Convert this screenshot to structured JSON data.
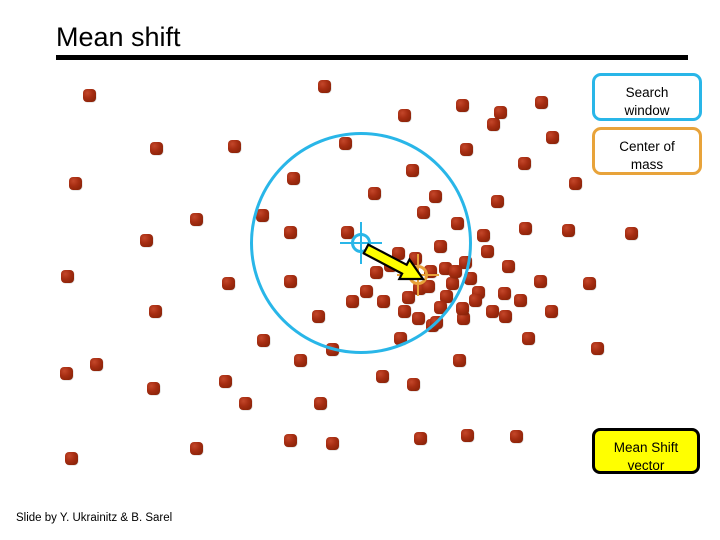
{
  "slide": {
    "title": "Mean shift",
    "footer": "Slide by Y. Ukrainitz & B. Sarel"
  },
  "legend": {
    "search_window": "Search\nwindow",
    "search_window_line1": "Search",
    "search_window_line2": "window",
    "center_of_mass_line1": "Center of",
    "center_of_mass_line2": "mass",
    "mean_shift_vector_line1": "Mean Shift",
    "mean_shift_vector_line2": "vector"
  },
  "colors": {
    "search_window": "#29b6e8",
    "center_of_mass": "#e8a33a",
    "mean_shift_vector": "#ffff00",
    "data_point": "#a62d12",
    "title_rule": "#000000",
    "background": "#ffffff"
  },
  "chart_data": {
    "type": "scatter",
    "title": "Mean shift",
    "xlabel": "",
    "ylabel": "",
    "xlim": [
      0,
      720
    ],
    "ylim": [
      0,
      440
    ],
    "grid": false,
    "legend_position": "right",
    "annotations": [
      {
        "name": "search-window-circle",
        "shape": "circle",
        "cx": 361,
        "cy": 243,
        "r": 111,
        "color": "#29b6e8"
      },
      {
        "name": "search-window-center-crosshair",
        "shape": "crosshair",
        "cx": 361,
        "cy": 243,
        "color": "#29b6e8"
      },
      {
        "name": "center-of-mass-crosshair",
        "shape": "crosshair",
        "cx": 418,
        "cy": 275,
        "color": "#e8a33a"
      },
      {
        "name": "mean-shift-vector-arrow",
        "shape": "arrow",
        "x1": 366,
        "y1": 249,
        "x2": 423,
        "y2": 279,
        "fill": "#ffff00",
        "stroke": "#000000"
      }
    ],
    "series": [
      {
        "name": "data points",
        "marker": "rounded-square",
        "size": 13,
        "color": "#a62d12",
        "points": [
          [
            89,
            95
          ],
          [
            324,
            86
          ],
          [
            462,
            105
          ],
          [
            541,
            102
          ],
          [
            156,
            148
          ],
          [
            234,
            146
          ],
          [
            345,
            143
          ],
          [
            404,
            115
          ],
          [
            493,
            124
          ],
          [
            552,
            137
          ],
          [
            75,
            183
          ],
          [
            293,
            178
          ],
          [
            412,
            170
          ],
          [
            466,
            149
          ],
          [
            524,
            163
          ],
          [
            575,
            183
          ],
          [
            196,
            219
          ],
          [
            262,
            215
          ],
          [
            374,
            193
          ],
          [
            435,
            196
          ],
          [
            497,
            201
          ],
          [
            525,
            228
          ],
          [
            568,
            230
          ],
          [
            146,
            240
          ],
          [
            290,
            232
          ],
          [
            347,
            232
          ],
          [
            423,
            212
          ],
          [
            457,
            223
          ],
          [
            487,
            251
          ],
          [
            631,
            233
          ],
          [
            67,
            276
          ],
          [
            228,
            283
          ],
          [
            290,
            281
          ],
          [
            398,
            253
          ],
          [
            440,
            246
          ],
          [
            465,
            262
          ],
          [
            508,
            266
          ],
          [
            155,
            311
          ],
          [
            318,
            316
          ],
          [
            383,
            301
          ],
          [
            419,
            288
          ],
          [
            446,
            296
          ],
          [
            478,
            292
          ],
          [
            540,
            281
          ],
          [
            589,
            283
          ],
          [
            96,
            364
          ],
          [
            263,
            340
          ],
          [
            332,
            349
          ],
          [
            400,
            338
          ],
          [
            432,
            325
          ],
          [
            463,
            318
          ],
          [
            505,
            316
          ],
          [
            551,
            311
          ],
          [
            66,
            373
          ],
          [
            153,
            388
          ],
          [
            320,
            403
          ],
          [
            382,
            376
          ],
          [
            413,
            384
          ],
          [
            459,
            360
          ],
          [
            528,
            338
          ],
          [
            71,
            458
          ],
          [
            196,
            448
          ],
          [
            290,
            440
          ],
          [
            332,
            443
          ],
          [
            420,
            438
          ],
          [
            467,
            435
          ],
          [
            516,
            436
          ],
          [
            597,
            348
          ],
          [
            500,
            112
          ],
          [
            445,
            268
          ],
          [
            430,
            271
          ],
          [
            452,
            283
          ],
          [
            408,
            297
          ],
          [
            440,
            307
          ],
          [
            462,
            308
          ],
          [
            415,
            258
          ],
          [
            428,
            286
          ],
          [
            455,
            271
          ],
          [
            470,
            278
          ],
          [
            475,
            300
          ],
          [
            492,
            311
          ],
          [
            436,
            322
          ],
          [
            404,
            311
          ],
          [
            418,
            318
          ],
          [
            390,
            265
          ],
          [
            376,
            272
          ],
          [
            483,
            235
          ],
          [
            504,
            293
          ],
          [
            520,
            300
          ],
          [
            352,
            301
          ],
          [
            366,
            291
          ],
          [
            300,
            360
          ],
          [
            225,
            381
          ],
          [
            245,
            403
          ]
        ]
      }
    ]
  }
}
